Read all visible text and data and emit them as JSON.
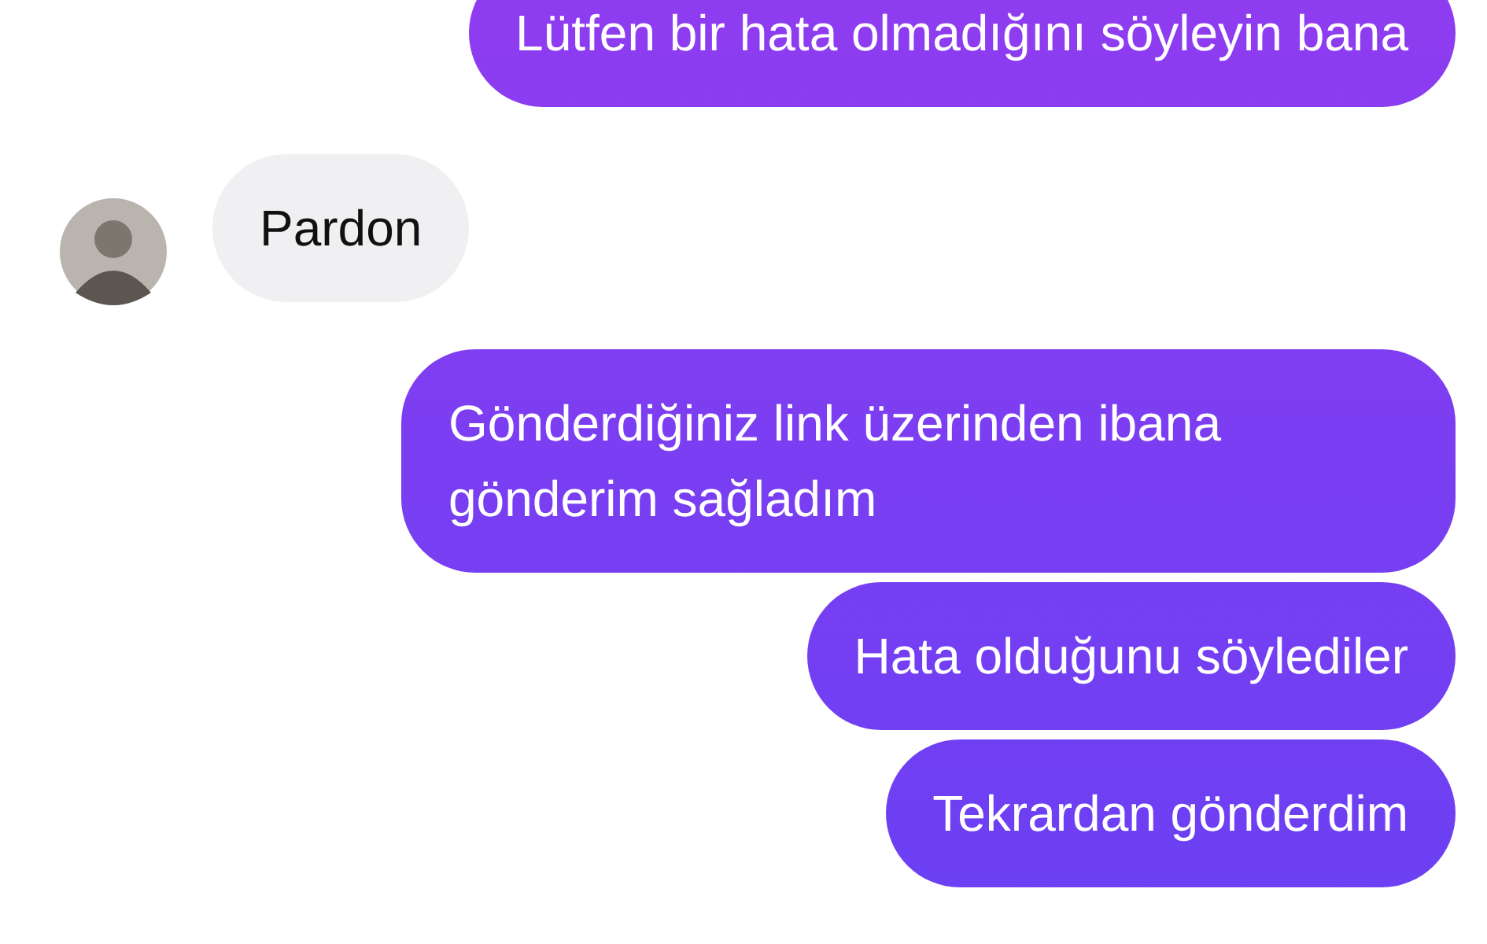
{
  "messages": [
    {
      "kind": "outgoing",
      "text": "Lütfen bir hata olmadığını söyleyin bana"
    },
    {
      "kind": "incoming",
      "text": "Pardon"
    },
    {
      "kind": "outgoing",
      "text": "Gönderdiğiniz link üzerinden ibana gönderim sağladım"
    },
    {
      "kind": "outgoing",
      "text": "Hata olduğunu söylediler"
    },
    {
      "kind": "outgoing",
      "text": "Tekrardan gönderdim"
    }
  ]
}
